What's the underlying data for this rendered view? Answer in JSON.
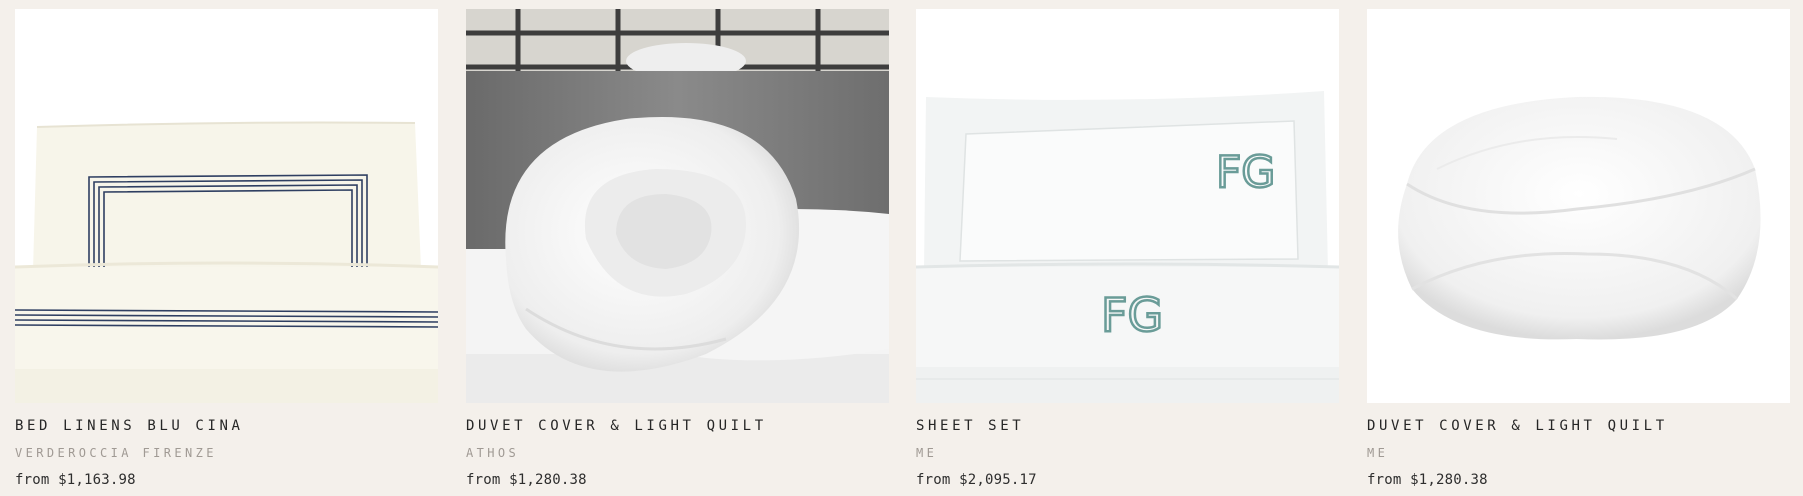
{
  "products": [
    {
      "title": "BED LINENS BLU CINA",
      "brand": "VERDEROCCIA FIRENZE",
      "price": "from $1,163.98",
      "image": "embroidered-bed-linen-photo"
    },
    {
      "title": "DUVET COVER & LIGHT QUILT",
      "brand": "ATHOS",
      "price": "from $1,280.38",
      "image": "rolled-quilt-on-bed-photo"
    },
    {
      "title": "SHEET SET",
      "brand": "ME",
      "price": "from $2,095.17",
      "image": "monogram-sheet-set-photo"
    },
    {
      "title": "DUVET COVER & LIGHT QUILT",
      "brand": "ME",
      "price": "from $1,280.38",
      "image": "folded-quilt-photo"
    }
  ],
  "monogram": "FG",
  "colors": {
    "background": "#f4f0eb",
    "navy_trim": "#2f3f62",
    "monogram_teal": "#6a9c98"
  }
}
